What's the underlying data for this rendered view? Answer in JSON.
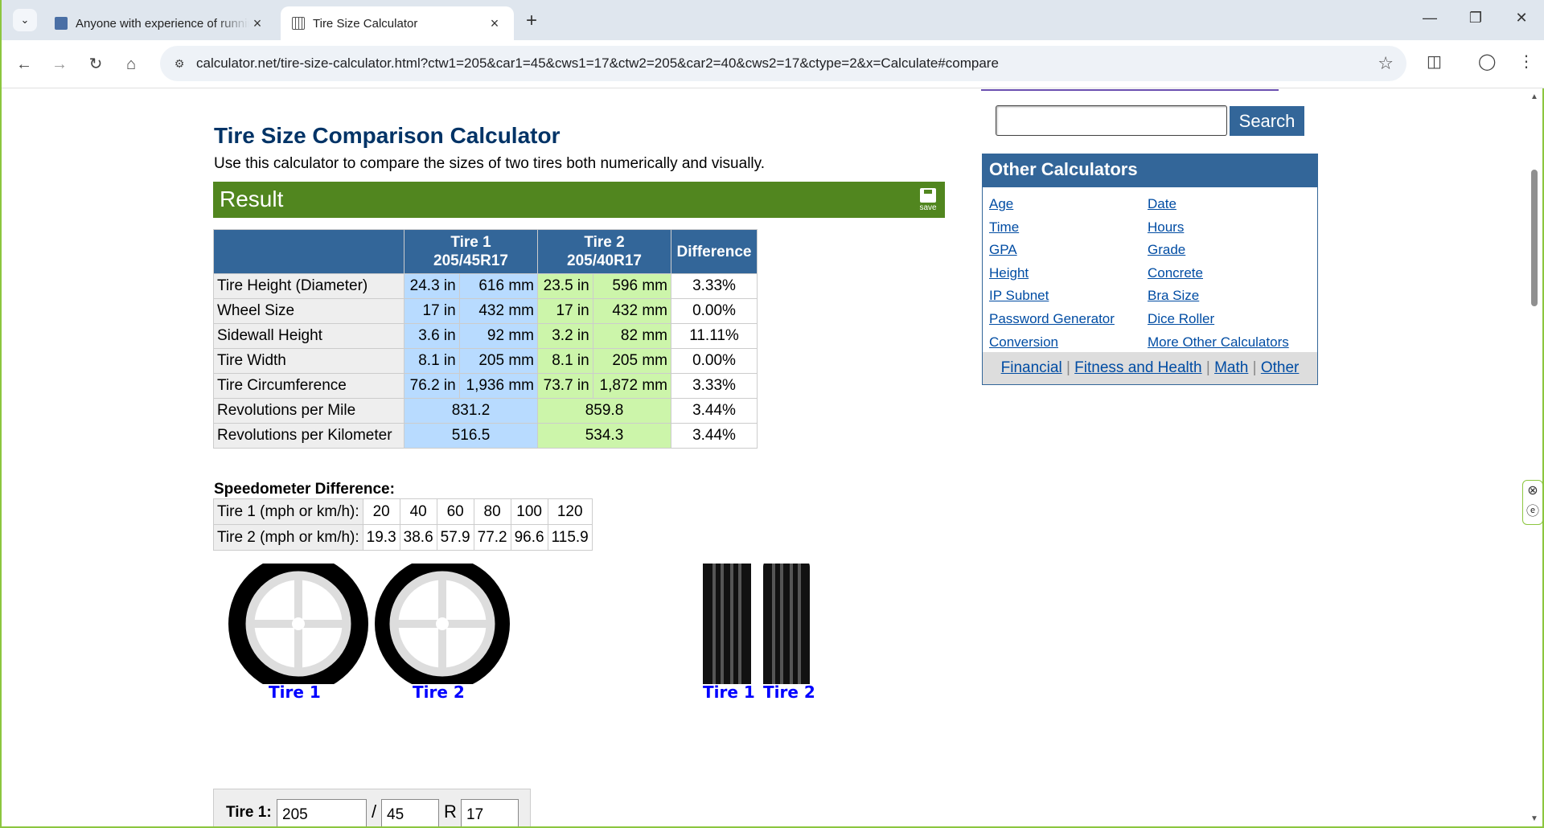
{
  "browser": {
    "tabs": [
      {
        "title": "Anyone with experience of running",
        "active": false
      },
      {
        "title": "Tire Size Calculator",
        "active": true
      }
    ],
    "url": "calculator.net/tire-size-calculator.html?ctw1=205&car1=45&cws1=17&ctw2=205&car2=40&cws2=17&ctype=2&x=Calculate#compare"
  },
  "page": {
    "title": "Tire Size Comparison Calculator",
    "intro": "Use this calculator to compare the sizes of two tires both numerically and visually.",
    "result_label": "Result",
    "save_label": "save"
  },
  "result_table": {
    "headers": {
      "tire1_line1": "Tire 1",
      "tire1_line2": "205/45R17",
      "tire2_line1": "Tire 2",
      "tire2_line2": "205/40R17",
      "difference": "Difference"
    },
    "rows": [
      {
        "label": "Tire Height (Diameter)",
        "t1_in": "24.3 in",
        "t1_mm": "616 mm",
        "t2_in": "23.5 in",
        "t2_mm": "596 mm",
        "diff": "3.33%"
      },
      {
        "label": "Wheel Size",
        "t1_in": "17 in",
        "t1_mm": "432 mm",
        "t2_in": "17 in",
        "t2_mm": "432 mm",
        "diff": "0.00%"
      },
      {
        "label": "Sidewall Height",
        "t1_in": "3.6 in",
        "t1_mm": "92 mm",
        "t2_in": "3.2 in",
        "t2_mm": "82 mm",
        "diff": "11.11%"
      },
      {
        "label": "Tire Width",
        "t1_in": "8.1 in",
        "t1_mm": "205 mm",
        "t2_in": "8.1 in",
        "t2_mm": "205 mm",
        "diff": "0.00%"
      },
      {
        "label": "Tire Circumference",
        "t1_in": "76.2 in",
        "t1_mm": "1,936 mm",
        "t2_in": "73.7 in",
        "t2_mm": "1,872 mm",
        "diff": "3.33%"
      },
      {
        "label": "Revolutions per Mile",
        "t1": "831.2",
        "t2": "859.8",
        "diff": "3.44%"
      },
      {
        "label": "Revolutions per Kilometer",
        "t1": "516.5",
        "t2": "534.3",
        "diff": "3.44%"
      }
    ]
  },
  "speedometer": {
    "title": "Speedometer Difference:",
    "tire1_label": "Tire 1 (mph or km/h):",
    "tire2_label": "Tire 2 (mph or km/h):",
    "tire1": [
      "20",
      "40",
      "60",
      "80",
      "100",
      "120"
    ],
    "tire2": [
      "19.3",
      "38.6",
      "57.9",
      "77.2",
      "96.6",
      "115.9"
    ]
  },
  "visual": {
    "side_labels": [
      "Tire 1",
      "Tire 2"
    ],
    "front_labels": [
      "Tire 1",
      "Tire 2"
    ]
  },
  "form": {
    "tire1_label": "Tire 1:",
    "width": "205",
    "aspect": "45",
    "rim": "17",
    "slash": "/",
    "r": "R"
  },
  "sidebar": {
    "search_button": "Search",
    "other_title": "Other Calculators",
    "col1": [
      "Age",
      "Time",
      "GPA",
      "Height",
      "IP Subnet",
      "Password Generator",
      "Conversion"
    ],
    "col2": [
      "Date",
      "Hours",
      "Grade",
      "Concrete",
      "Bra Size",
      "Dice Roller",
      "More Other Calculators"
    ],
    "footer": [
      "Financial",
      "Fitness and Health",
      "Math",
      "Other"
    ]
  },
  "colors": {
    "result_green": "#51861f",
    "header_blue": "#336699",
    "tire1_blue": "#b8dbff",
    "tire2_green": "#ccf5aa",
    "link_blue": "#004ca3"
  }
}
